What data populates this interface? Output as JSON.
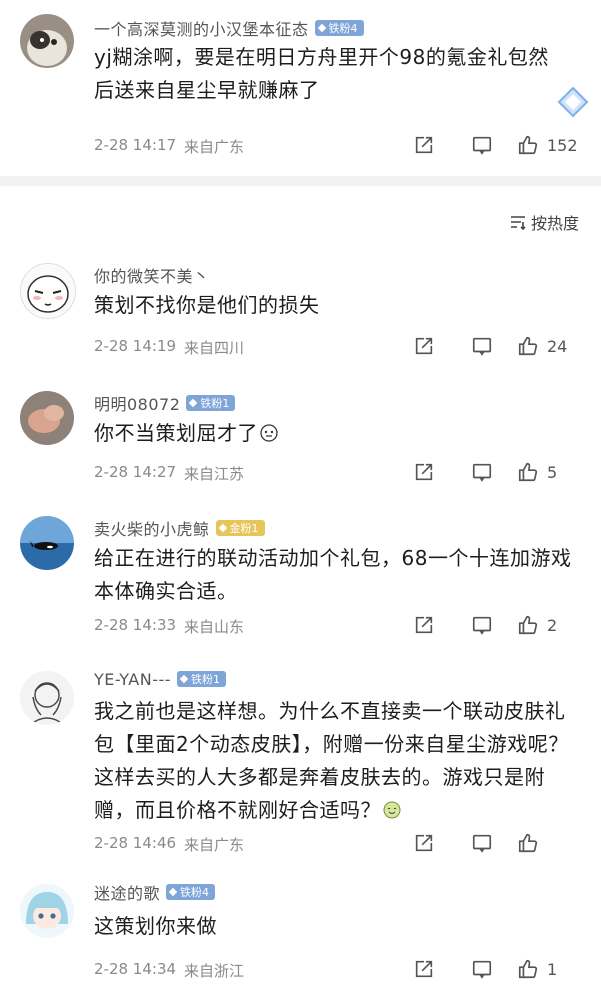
{
  "sort": {
    "label": "按热度"
  },
  "colors": {
    "badge_blue": "#7fa5d8",
    "badge_yellow": "#e8c55a",
    "meta": "#8a8a8a"
  },
  "comments": [
    {
      "username": "一个高深莫测的小汉堡本征态",
      "badge": "铁粉4",
      "badge_color": "blue",
      "text": "yj糊涂啊，要是在明日方舟里开个98的氪金礼包然后送来自星尘早就赚麻了",
      "time": "2-28 14:17",
      "location": "来自广东",
      "likes": "152",
      "avatar": "cat-avatar"
    },
    {
      "username": "你的微笑不美丶",
      "badge": "",
      "badge_color": "",
      "text": "策划不找你是他们的损失",
      "time": "2-28 14:19",
      "location": "来自四川",
      "likes": "24",
      "avatar": "meme-face-avatar"
    },
    {
      "username": "明明08072",
      "badge": "铁粉1",
      "badge_color": "blue",
      "text": "你不当策划屈才了",
      "time": "2-28 14:27",
      "location": "来自江苏",
      "likes": "5",
      "avatar": "hand-photo-avatar"
    },
    {
      "username": "卖火柴的小虎鲸",
      "badge": "金粉1",
      "badge_color": "yellow",
      "text": "给正在进行的联动活动加个礼包，68一个十连加游戏本体确实合适。",
      "time": "2-28 14:33",
      "location": "来自山东",
      "likes": "2",
      "avatar": "orca-avatar"
    },
    {
      "username": "YE-YAN---",
      "badge": "铁粉1",
      "badge_color": "blue",
      "text": "我之前也是这样想。为什么不直接卖一个联动皮肤礼包【里面2个动态皮肤】，附赠一份来自星尘游戏呢？这样去买的人大多都是奔着皮肤去的。游戏只是附赠，而且价格不就刚好合适吗？",
      "time": "2-28 14:46",
      "location": "来自广东",
      "likes": "",
      "avatar": "sketch-avatar"
    },
    {
      "username": "迷途的歌",
      "badge": "铁粉4",
      "badge_color": "blue",
      "text": "这策划你来做",
      "time": "2-28 14:34",
      "location": "来自浙江",
      "likes": "1",
      "avatar": "anime-girl-avatar"
    }
  ]
}
